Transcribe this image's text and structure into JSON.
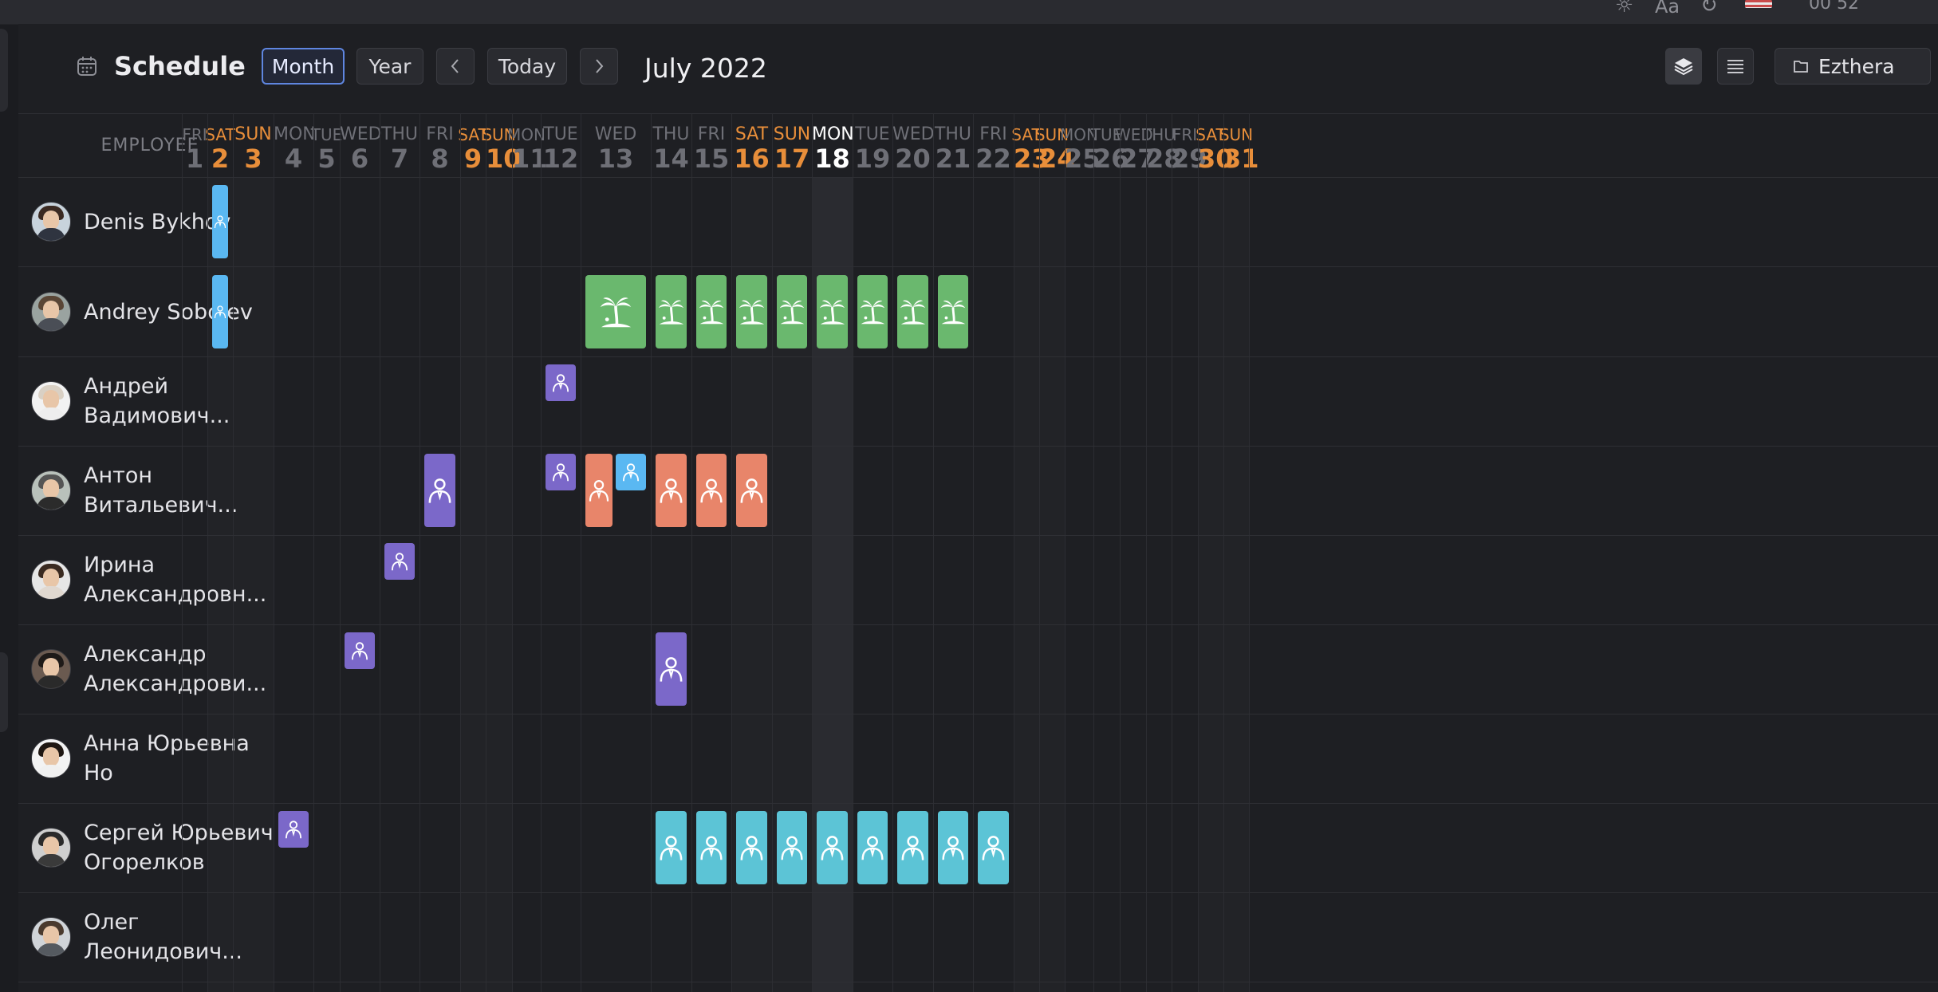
{
  "topbar": {
    "font_icon_label": "Aa",
    "time_partial": "00 52",
    "locale_flag": "us-flag"
  },
  "header": {
    "title": "Schedule",
    "title_icon": "calendar-icon",
    "view_month": "Month",
    "view_year": "Year",
    "prev_icon": "chevron-left-icon",
    "today": "Today",
    "next_icon": "chevron-right-icon",
    "current_period": "July 2022",
    "layers_icon": "layers-icon",
    "list_icon": "list-icon",
    "org_icon": "folder-icon",
    "org_name": "Ezthera"
  },
  "grid": {
    "employee_header": "EMPLOYEE",
    "days": [
      {
        "w": "FRI",
        "d": "1"
      },
      {
        "w": "SAT",
        "d": "2"
      },
      {
        "w": "SUN",
        "d": "3"
      },
      {
        "w": "MON",
        "d": "4"
      },
      {
        "w": "TUE",
        "d": "5"
      },
      {
        "w": "WED",
        "d": "6"
      },
      {
        "w": "THU",
        "d": "7"
      },
      {
        "w": "FRI",
        "d": "8"
      },
      {
        "w": "SAT",
        "d": "9"
      },
      {
        "w": "SUN",
        "d": "10"
      },
      {
        "w": "MON",
        "d": "11"
      },
      {
        "w": "TUE",
        "d": "12"
      },
      {
        "w": "WED",
        "d": "13"
      },
      {
        "w": "THU",
        "d": "14"
      },
      {
        "w": "FRI",
        "d": "15"
      },
      {
        "w": "SAT",
        "d": "16"
      },
      {
        "w": "SUN",
        "d": "17"
      },
      {
        "w": "MON",
        "d": "18"
      },
      {
        "w": "TUE",
        "d": "19"
      },
      {
        "w": "WED",
        "d": "20"
      },
      {
        "w": "THU",
        "d": "21"
      },
      {
        "w": "FRI",
        "d": "22"
      },
      {
        "w": "SAT",
        "d": "23"
      },
      {
        "w": "SUN",
        "d": "24"
      },
      {
        "w": "MON",
        "d": "25"
      },
      {
        "w": "TUE",
        "d": "26"
      },
      {
        "w": "WED",
        "d": "27"
      },
      {
        "w": "THU",
        "d": "28"
      },
      {
        "w": "FRI",
        "d": "29"
      },
      {
        "w": "SAT",
        "d": "30"
      },
      {
        "w": "SUN",
        "d": "31"
      }
    ],
    "today_day": "18",
    "weekend_color": "#e88e3a",
    "employees": [
      {
        "name": "Denis Bykhov"
      },
      {
        "name": "Andrey Sobolev"
      },
      {
        "name": "Андрей Вадимович..."
      },
      {
        "name": "Антон Витальевич..."
      },
      {
        "name": "Ирина Александровн..."
      },
      {
        "name": "Александр Александрови..."
      },
      {
        "name": "Анна Юрьевна Но"
      },
      {
        "name": "Сергей Юрьевич Огорелков"
      },
      {
        "name": "Олег Леонидович..."
      }
    ],
    "event_colors": {
      "blue": "#5ab8f2",
      "green": "#6ab86e",
      "purple": "#7b68c9",
      "orange": "#e8856a",
      "cyan": "#5cc4d6"
    },
    "events": [
      {
        "row": 0,
        "day": 2,
        "type": "blue",
        "icon": "person-tie-icon"
      },
      {
        "row": 1,
        "day": 2,
        "type": "blue",
        "icon": "person-tie-icon"
      },
      {
        "row": 1,
        "day": 13,
        "type": "green",
        "icon": "palm-tree-icon"
      },
      {
        "row": 1,
        "day": 14,
        "type": "green",
        "icon": "palm-tree-icon"
      },
      {
        "row": 1,
        "day": 15,
        "type": "green",
        "icon": "palm-tree-icon"
      },
      {
        "row": 1,
        "day": 16,
        "type": "green",
        "icon": "palm-tree-icon"
      },
      {
        "row": 1,
        "day": 17,
        "type": "green",
        "icon": "palm-tree-icon"
      },
      {
        "row": 1,
        "day": 18,
        "type": "green",
        "icon": "palm-tree-icon"
      },
      {
        "row": 1,
        "day": 19,
        "type": "green",
        "icon": "palm-tree-icon"
      },
      {
        "row": 1,
        "day": 20,
        "type": "green",
        "icon": "palm-tree-icon"
      },
      {
        "row": 1,
        "day": 21,
        "type": "green",
        "icon": "palm-tree-icon"
      },
      {
        "row": 2,
        "day": 12,
        "type": "purple",
        "icon": "person-tie-icon",
        "part": "half"
      },
      {
        "row": 3,
        "day": 8,
        "type": "purple",
        "icon": "person-tie-icon"
      },
      {
        "row": 3,
        "day": 12,
        "type": "purple",
        "icon": "person-tie-icon",
        "part": "half"
      },
      {
        "row": 3,
        "day": 13,
        "type": "orange",
        "icon": "person-tie-icon",
        "part": "first-half"
      },
      {
        "row": 3,
        "day": 13,
        "type": "blue",
        "icon": "person-tie-icon",
        "part": "second-half"
      },
      {
        "row": 3,
        "day": 14,
        "type": "orange",
        "icon": "person-tie-icon"
      },
      {
        "row": 3,
        "day": 15,
        "type": "orange",
        "icon": "person-tie-icon"
      },
      {
        "row": 3,
        "day": 16,
        "type": "orange",
        "icon": "person-tie-icon"
      },
      {
        "row": 4,
        "day": 7,
        "type": "purple",
        "icon": "person-tie-icon",
        "part": "half"
      },
      {
        "row": 5,
        "day": 6,
        "type": "purple",
        "icon": "person-tie-icon",
        "part": "half"
      },
      {
        "row": 5,
        "day": 14,
        "type": "purple",
        "icon": "person-tie-icon"
      },
      {
        "row": 7,
        "day": 4,
        "type": "purple",
        "icon": "person-tie-icon",
        "part": "half"
      },
      {
        "row": 7,
        "day": 14,
        "type": "cyan",
        "icon": "person-tie-icon"
      },
      {
        "row": 7,
        "day": 15,
        "type": "cyan",
        "icon": "person-tie-icon"
      },
      {
        "row": 7,
        "day": 16,
        "type": "cyan",
        "icon": "person-tie-icon"
      },
      {
        "row": 7,
        "day": 17,
        "type": "cyan",
        "icon": "person-tie-icon"
      },
      {
        "row": 7,
        "day": 18,
        "type": "cyan",
        "icon": "person-tie-icon"
      },
      {
        "row": 7,
        "day": 19,
        "type": "cyan",
        "icon": "person-tie-icon"
      },
      {
        "row": 7,
        "day": 20,
        "type": "cyan",
        "icon": "person-tie-icon"
      },
      {
        "row": 7,
        "day": 21,
        "type": "cyan",
        "icon": "person-tie-icon"
      },
      {
        "row": 7,
        "day": 22,
        "type": "cyan",
        "icon": "person-tie-icon"
      }
    ]
  }
}
